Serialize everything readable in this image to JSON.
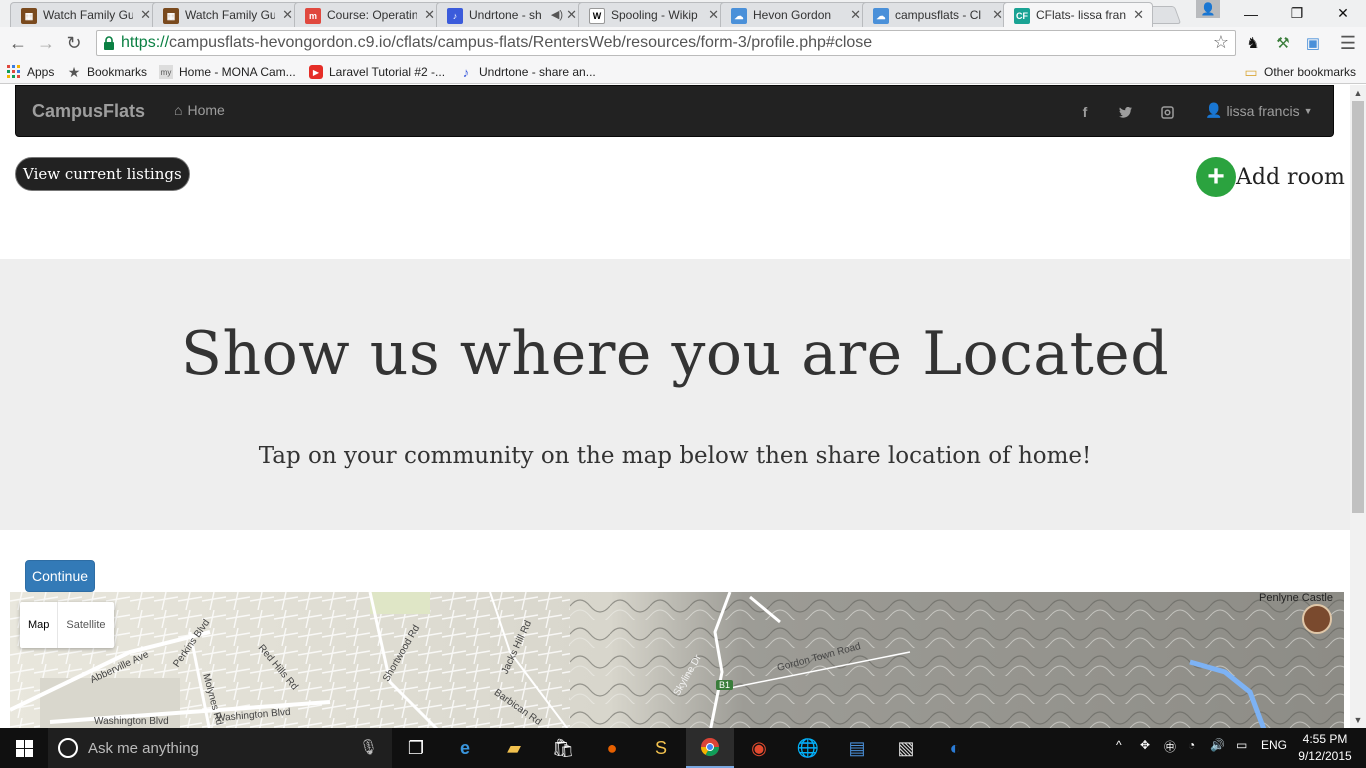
{
  "browser": {
    "tabs": [
      {
        "label": "Watch Family Gu",
        "icon": "film-icon",
        "color": "#7a4a1e"
      },
      {
        "label": "Watch Family Gu",
        "icon": "film-icon",
        "color": "#7a4a1e"
      },
      {
        "label": "Course: Operatin",
        "icon": "moodle-icon",
        "color": "#e0483e"
      },
      {
        "label": "Undrtone - sh",
        "icon": "undrtone-icon",
        "color": "#3b5bdb"
      },
      {
        "label": "Spooling - Wikip",
        "icon": "wikipedia-icon",
        "color": "#ffffff"
      },
      {
        "label": "Hevon Gordon",
        "icon": "cloud9-icon",
        "color": "#4a90d9"
      },
      {
        "label": "campusflats - Cl",
        "icon": "cloud9-icon",
        "color": "#4a90d9"
      },
      {
        "label": "CFlats- lissa franc",
        "icon": "cf-icon",
        "color": "#1aa394",
        "active": true
      }
    ],
    "url_scheme": "https://",
    "url_rest": "campusflats-hevongordon.c9.io/cflats/campus-flats/RentersWeb/resources/form-3/profile.php#close",
    "bookmarks": [
      {
        "label": "Apps",
        "icon": "apps-grid-icon"
      },
      {
        "label": "Bookmarks",
        "icon": "star-icon"
      },
      {
        "label": "Home - MONA Cam...",
        "icon": "page-icon"
      },
      {
        "label": "Laravel Tutorial #2 -...",
        "icon": "youtube-icon"
      },
      {
        "label": "Undrtone - share an...",
        "icon": "undrtone-icon"
      }
    ],
    "other_bookmarks": "Other bookmarks"
  },
  "page": {
    "brand": "CampusFlats",
    "nav_home": "Home",
    "user_name": "lissa francis",
    "listings_button": "View current listings",
    "add_room": "Add room",
    "heading": "Show us where you are Located",
    "subheading": "Tap on your community on the map below then share location of home!",
    "continue_button": "Continue",
    "map": {
      "type_map": "Map",
      "type_satellite": "Satellite",
      "labels": [
        "Perkins Blvd",
        "Abberville Ave",
        "Molynes Rd",
        "Red Hills Rd",
        "Washington Blvd",
        "Washington Blvd",
        "Shortwood Rd",
        "Jacks Hill Rd",
        "Barbican Rd",
        "Skyline Dr",
        "Gordon Town Road",
        "Penlyne Castle",
        "B1"
      ]
    },
    "accent_color": "#337ab7",
    "add_color": "#2ba33f"
  },
  "taskbar": {
    "search_placeholder": "Ask me anything",
    "language": "ENG",
    "time": "4:55 PM",
    "date": "9/12/2015"
  }
}
